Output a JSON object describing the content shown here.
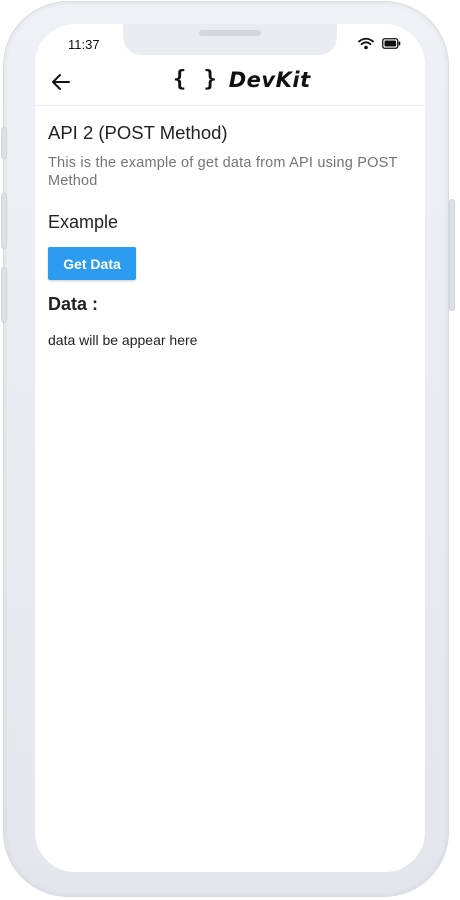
{
  "status_bar": {
    "time": "11:37"
  },
  "appbar": {
    "braces": "{ }",
    "title": "DevKit"
  },
  "content": {
    "title": "API 2 (POST Method)",
    "description": "This is the example of get data from API using POST Method",
    "example_heading": "Example",
    "button_label": "Get Data",
    "data_heading": "Data :",
    "data_text": "data will be appear here"
  },
  "colors": {
    "button": "#2d9cf0",
    "description": "#757575"
  },
  "icons": [
    "back-arrow-icon",
    "wifi-icon",
    "battery-icon"
  ]
}
